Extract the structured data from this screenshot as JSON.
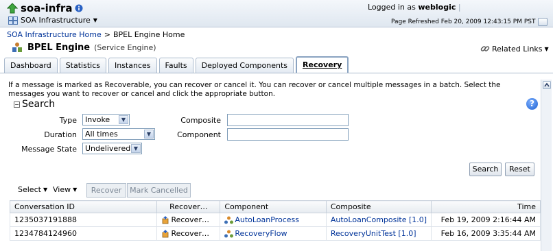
{
  "header": {
    "app_title": "soa-infra",
    "nav_menu_label": "SOA Infrastructure",
    "logged_in_prefix": "Logged in as",
    "username": "weblogic",
    "page_refreshed": "Page Refreshed Feb 20, 2009 12:43:15 PM PST"
  },
  "breadcrumb": {
    "items": [
      "SOA Infrastructure Home",
      ">",
      "BPEL Engine Home"
    ]
  },
  "page": {
    "title": "BPEL Engine",
    "subtitle": "(Service Engine)",
    "related_links": "Related Links"
  },
  "tabs": [
    {
      "label": "Dashboard"
    },
    {
      "label": "Statistics"
    },
    {
      "label": "Instances"
    },
    {
      "label": "Faults"
    },
    {
      "label": "Deployed Components"
    },
    {
      "label": "Recovery"
    }
  ],
  "description": "If a message is marked as Recoverable, you can recover or cancel it. You can recover or cancel multiple messages in a batch. Select the messages you want to recover or cancel and click the appropriate button.",
  "search": {
    "title": "Search",
    "type_label": "Type",
    "type_value": "Invoke",
    "duration_label": "Duration",
    "duration_value": "All times",
    "message_state_label": "Message State",
    "message_state_value": "Undelivered",
    "composite_label": "Composite",
    "component_label": "Component",
    "search_button": "Search",
    "reset_button": "Reset"
  },
  "toolbar": {
    "select_label": "Select",
    "view_label": "View",
    "recover_button": "Recover",
    "mark_cancelled_button": "Mark Cancelled"
  },
  "table": {
    "columns": [
      "Conversation ID",
      "Recover…",
      "Component",
      "Composite",
      "Time"
    ],
    "rows": [
      {
        "conversation_id": "1235037191888",
        "recover": "Recover…",
        "component": "AutoLoanProcess",
        "composite": "AutoLoanComposite [1.0]",
        "time": "Feb 19, 2009 2:16:44 AM"
      },
      {
        "conversation_id": "1234784124960",
        "recover": "Recover…",
        "component": "RecoveryFlow",
        "composite": "RecoveryUnitTest [1.0]",
        "time": "Feb 16, 2009 3:35:44 AM"
      }
    ]
  }
}
